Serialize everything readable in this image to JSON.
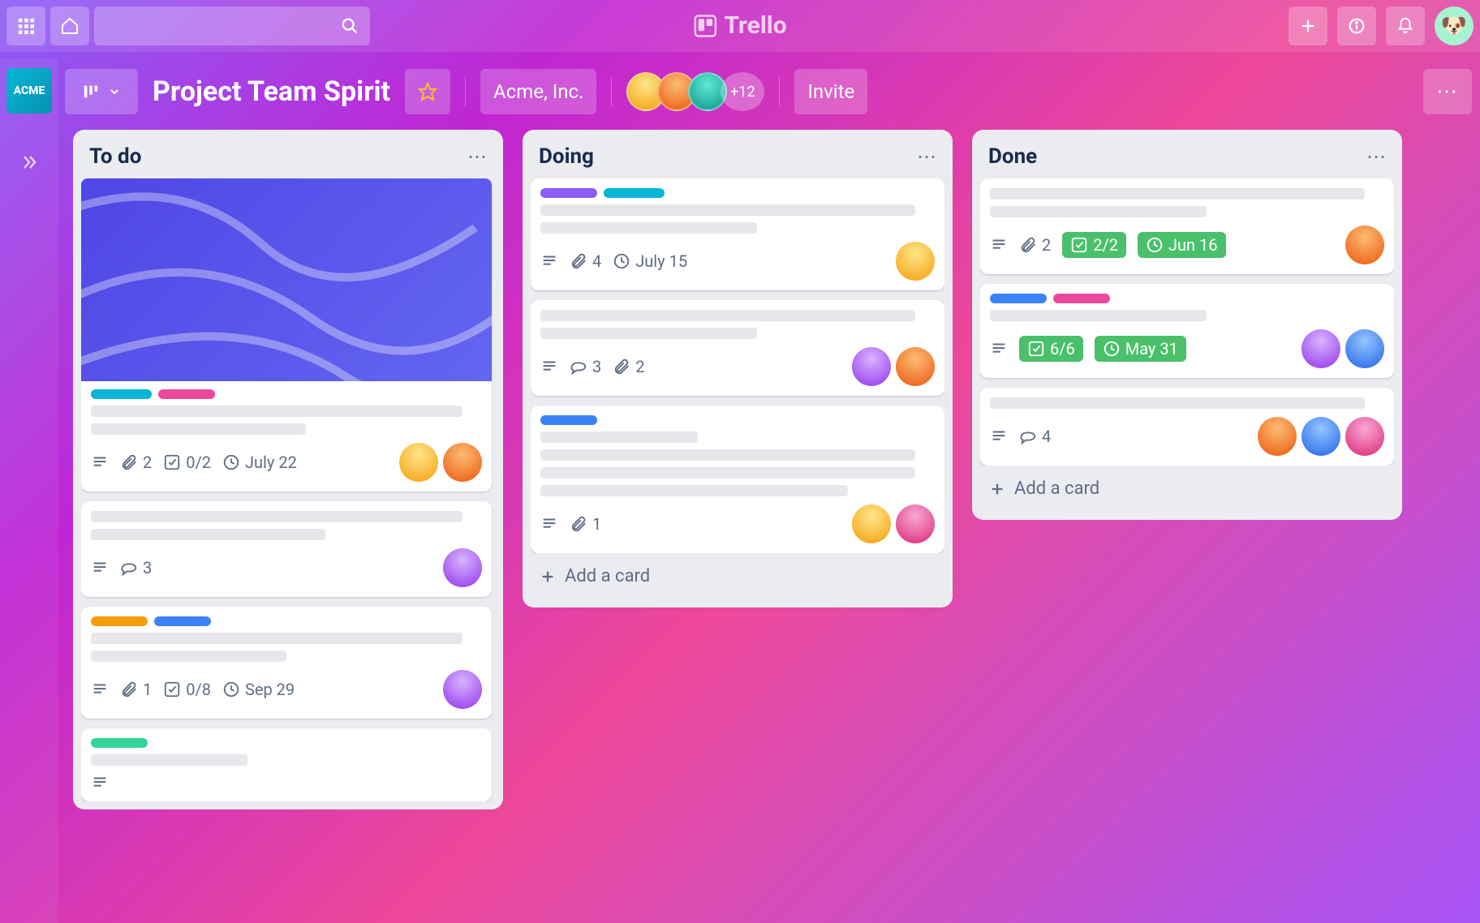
{
  "brand": "Trello",
  "left_rail": {
    "workspace_badge": "ACME"
  },
  "board_header": {
    "title": "Project Team Spirit",
    "team_name": "Acme, Inc.",
    "extra_members": "+12",
    "invite_label": "Invite"
  },
  "colors": {
    "label_cyan": "#06b6d4",
    "label_pink": "#ec4899",
    "label_yellow": "#f59e0b",
    "label_blue": "#3b82f6",
    "label_green": "#34d399",
    "label_purple": "#8b5cf6"
  },
  "lists": [
    {
      "title": "To do",
      "add_card": "Add a card",
      "cards": [
        {
          "cover": true,
          "labels": [
            "cyan",
            "pink"
          ],
          "lines": [
            0.95,
            0.55
          ],
          "attachments": "2",
          "checklist": "0/2",
          "checklist_done": false,
          "due": "July 22",
          "due_done": false,
          "members": [
            "yellow",
            "orange"
          ]
        },
        {
          "labels": [],
          "lines": [
            0.95,
            0.6
          ],
          "comments": "3",
          "members": [
            "purple"
          ]
        },
        {
          "labels": [
            "yellow",
            "blue"
          ],
          "lines": [
            0.95,
            0.5
          ],
          "attachments": "1",
          "checklist": "0/8",
          "checklist_done": false,
          "due": "Sep 29",
          "due_done": false,
          "members": [
            "purple"
          ]
        },
        {
          "labels": [
            "green"
          ],
          "lines": [
            0.4
          ],
          "members": []
        }
      ]
    },
    {
      "title": "Doing",
      "add_card": "Add a card",
      "cards": [
        {
          "labels": [
            "purple",
            "cyan"
          ],
          "lines": [
            0.95,
            0.55
          ],
          "attachments": "4",
          "due": "July 15",
          "due_done": false,
          "members": [
            "yellow"
          ]
        },
        {
          "labels": [],
          "lines": [
            0.95,
            0.55
          ],
          "comments": "3",
          "attachments": "2",
          "members": [
            "purple",
            "orange"
          ]
        },
        {
          "labels": [
            "blue"
          ],
          "lines": [
            0.4,
            0.95,
            0.95,
            0.78
          ],
          "attachments": "1",
          "members": [
            "yellow",
            "pink"
          ]
        }
      ]
    },
    {
      "title": "Done",
      "add_card": "Add a card",
      "cards": [
        {
          "labels": [],
          "lines": [
            0.95,
            0.55
          ],
          "attachments": "2",
          "checklist": "2/2",
          "checklist_done": true,
          "due": "Jun 16",
          "due_done": true,
          "members": [
            "orange"
          ]
        },
        {
          "labels": [
            "blue",
            "pink"
          ],
          "lines": [
            0.55
          ],
          "checklist": "6/6",
          "checklist_done": true,
          "due": "May 31",
          "due_done": true,
          "members": [
            "purple",
            "blue"
          ]
        },
        {
          "labels": [],
          "lines": [
            0.95
          ],
          "comments": "4",
          "members": [
            "orange",
            "blue",
            "pink"
          ]
        }
      ]
    }
  ]
}
